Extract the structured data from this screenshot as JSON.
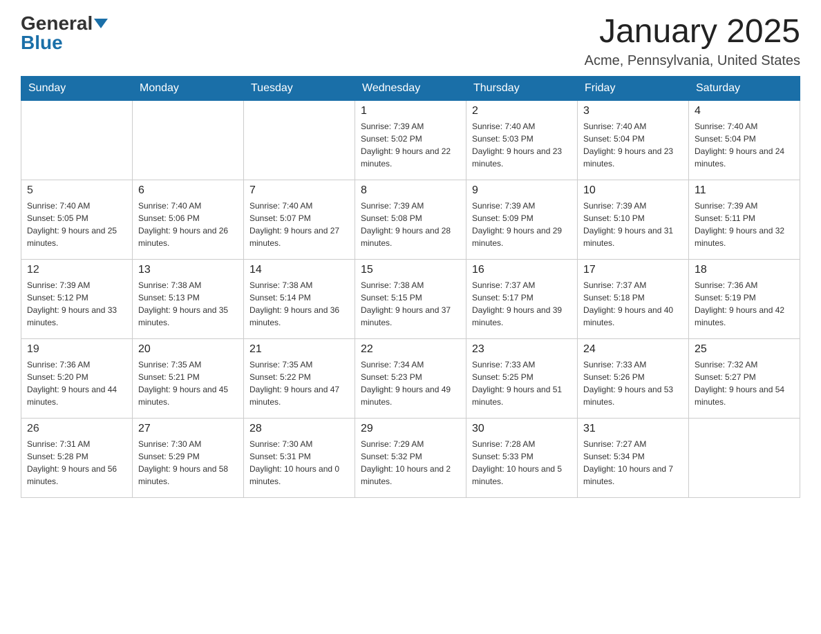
{
  "logo": {
    "general": "General",
    "blue": "Blue"
  },
  "title": {
    "month": "January 2025",
    "location": "Acme, Pennsylvania, United States"
  },
  "days_of_week": [
    "Sunday",
    "Monday",
    "Tuesday",
    "Wednesday",
    "Thursday",
    "Friday",
    "Saturday"
  ],
  "weeks": [
    [
      {
        "day": "",
        "sunrise": "",
        "sunset": "",
        "daylight": ""
      },
      {
        "day": "",
        "sunrise": "",
        "sunset": "",
        "daylight": ""
      },
      {
        "day": "",
        "sunrise": "",
        "sunset": "",
        "daylight": ""
      },
      {
        "day": "1",
        "sunrise": "Sunrise: 7:39 AM",
        "sunset": "Sunset: 5:02 PM",
        "daylight": "Daylight: 9 hours and 22 minutes."
      },
      {
        "day": "2",
        "sunrise": "Sunrise: 7:40 AM",
        "sunset": "Sunset: 5:03 PM",
        "daylight": "Daylight: 9 hours and 23 minutes."
      },
      {
        "day": "3",
        "sunrise": "Sunrise: 7:40 AM",
        "sunset": "Sunset: 5:04 PM",
        "daylight": "Daylight: 9 hours and 23 minutes."
      },
      {
        "day": "4",
        "sunrise": "Sunrise: 7:40 AM",
        "sunset": "Sunset: 5:04 PM",
        "daylight": "Daylight: 9 hours and 24 minutes."
      }
    ],
    [
      {
        "day": "5",
        "sunrise": "Sunrise: 7:40 AM",
        "sunset": "Sunset: 5:05 PM",
        "daylight": "Daylight: 9 hours and 25 minutes."
      },
      {
        "day": "6",
        "sunrise": "Sunrise: 7:40 AM",
        "sunset": "Sunset: 5:06 PM",
        "daylight": "Daylight: 9 hours and 26 minutes."
      },
      {
        "day": "7",
        "sunrise": "Sunrise: 7:40 AM",
        "sunset": "Sunset: 5:07 PM",
        "daylight": "Daylight: 9 hours and 27 minutes."
      },
      {
        "day": "8",
        "sunrise": "Sunrise: 7:39 AM",
        "sunset": "Sunset: 5:08 PM",
        "daylight": "Daylight: 9 hours and 28 minutes."
      },
      {
        "day": "9",
        "sunrise": "Sunrise: 7:39 AM",
        "sunset": "Sunset: 5:09 PM",
        "daylight": "Daylight: 9 hours and 29 minutes."
      },
      {
        "day": "10",
        "sunrise": "Sunrise: 7:39 AM",
        "sunset": "Sunset: 5:10 PM",
        "daylight": "Daylight: 9 hours and 31 minutes."
      },
      {
        "day": "11",
        "sunrise": "Sunrise: 7:39 AM",
        "sunset": "Sunset: 5:11 PM",
        "daylight": "Daylight: 9 hours and 32 minutes."
      }
    ],
    [
      {
        "day": "12",
        "sunrise": "Sunrise: 7:39 AM",
        "sunset": "Sunset: 5:12 PM",
        "daylight": "Daylight: 9 hours and 33 minutes."
      },
      {
        "day": "13",
        "sunrise": "Sunrise: 7:38 AM",
        "sunset": "Sunset: 5:13 PM",
        "daylight": "Daylight: 9 hours and 35 minutes."
      },
      {
        "day": "14",
        "sunrise": "Sunrise: 7:38 AM",
        "sunset": "Sunset: 5:14 PM",
        "daylight": "Daylight: 9 hours and 36 minutes."
      },
      {
        "day": "15",
        "sunrise": "Sunrise: 7:38 AM",
        "sunset": "Sunset: 5:15 PM",
        "daylight": "Daylight: 9 hours and 37 minutes."
      },
      {
        "day": "16",
        "sunrise": "Sunrise: 7:37 AM",
        "sunset": "Sunset: 5:17 PM",
        "daylight": "Daylight: 9 hours and 39 minutes."
      },
      {
        "day": "17",
        "sunrise": "Sunrise: 7:37 AM",
        "sunset": "Sunset: 5:18 PM",
        "daylight": "Daylight: 9 hours and 40 minutes."
      },
      {
        "day": "18",
        "sunrise": "Sunrise: 7:36 AM",
        "sunset": "Sunset: 5:19 PM",
        "daylight": "Daylight: 9 hours and 42 minutes."
      }
    ],
    [
      {
        "day": "19",
        "sunrise": "Sunrise: 7:36 AM",
        "sunset": "Sunset: 5:20 PM",
        "daylight": "Daylight: 9 hours and 44 minutes."
      },
      {
        "day": "20",
        "sunrise": "Sunrise: 7:35 AM",
        "sunset": "Sunset: 5:21 PM",
        "daylight": "Daylight: 9 hours and 45 minutes."
      },
      {
        "day": "21",
        "sunrise": "Sunrise: 7:35 AM",
        "sunset": "Sunset: 5:22 PM",
        "daylight": "Daylight: 9 hours and 47 minutes."
      },
      {
        "day": "22",
        "sunrise": "Sunrise: 7:34 AM",
        "sunset": "Sunset: 5:23 PM",
        "daylight": "Daylight: 9 hours and 49 minutes."
      },
      {
        "day": "23",
        "sunrise": "Sunrise: 7:33 AM",
        "sunset": "Sunset: 5:25 PM",
        "daylight": "Daylight: 9 hours and 51 minutes."
      },
      {
        "day": "24",
        "sunrise": "Sunrise: 7:33 AM",
        "sunset": "Sunset: 5:26 PM",
        "daylight": "Daylight: 9 hours and 53 minutes."
      },
      {
        "day": "25",
        "sunrise": "Sunrise: 7:32 AM",
        "sunset": "Sunset: 5:27 PM",
        "daylight": "Daylight: 9 hours and 54 minutes."
      }
    ],
    [
      {
        "day": "26",
        "sunrise": "Sunrise: 7:31 AM",
        "sunset": "Sunset: 5:28 PM",
        "daylight": "Daylight: 9 hours and 56 minutes."
      },
      {
        "day": "27",
        "sunrise": "Sunrise: 7:30 AM",
        "sunset": "Sunset: 5:29 PM",
        "daylight": "Daylight: 9 hours and 58 minutes."
      },
      {
        "day": "28",
        "sunrise": "Sunrise: 7:30 AM",
        "sunset": "Sunset: 5:31 PM",
        "daylight": "Daylight: 10 hours and 0 minutes."
      },
      {
        "day": "29",
        "sunrise": "Sunrise: 7:29 AM",
        "sunset": "Sunset: 5:32 PM",
        "daylight": "Daylight: 10 hours and 2 minutes."
      },
      {
        "day": "30",
        "sunrise": "Sunrise: 7:28 AM",
        "sunset": "Sunset: 5:33 PM",
        "daylight": "Daylight: 10 hours and 5 minutes."
      },
      {
        "day": "31",
        "sunrise": "Sunrise: 7:27 AM",
        "sunset": "Sunset: 5:34 PM",
        "daylight": "Daylight: 10 hours and 7 minutes."
      },
      {
        "day": "",
        "sunrise": "",
        "sunset": "",
        "daylight": ""
      }
    ]
  ]
}
